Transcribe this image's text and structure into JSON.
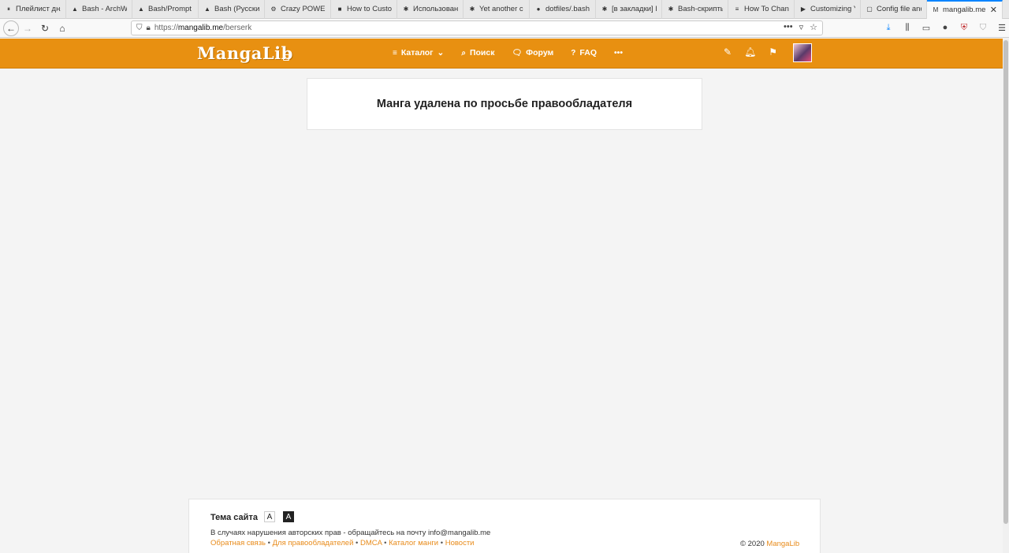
{
  "browser": {
    "tabs": [
      {
        "title": "Плейлист дня",
        "icon": "pause-icon",
        "fav": "⏸"
      },
      {
        "title": "Bash - ArchWiki",
        "icon": "arch-icon",
        "fav": "▲"
      },
      {
        "title": "Bash/Prompt",
        "icon": "arch-icon",
        "fav": "▲"
      },
      {
        "title": "Bash (Русский)",
        "icon": "arch-icon",
        "fav": "▲"
      },
      {
        "title": "Crazy POWERFUL",
        "icon": "site-icon",
        "fav": "⚙"
      },
      {
        "title": "How to Custom",
        "icon": "htg-icon",
        "fav": "■"
      },
      {
        "title": "Использован",
        "icon": "site-icon",
        "fav": "✱"
      },
      {
        "title": "Yet another c",
        "icon": "site-icon",
        "fav": "✱"
      },
      {
        "title": "dotfiles/.bash",
        "icon": "github-icon",
        "fav": "●"
      },
      {
        "title": "[в закладки] Б",
        "icon": "site-icon",
        "fav": "✱"
      },
      {
        "title": "Bash-скрипты",
        "icon": "site-icon",
        "fav": "✱"
      },
      {
        "title": "How To Chang",
        "icon": "site-icon",
        "fav": "≡"
      },
      {
        "title": "Customizing Y",
        "icon": "youtube-icon",
        "fav": "▶"
      },
      {
        "title": "Config file and",
        "icon": "doc-icon",
        "fav": "▢"
      },
      {
        "title": "mangalib.me",
        "icon": "mangalib-icon",
        "fav": "M",
        "active": true
      }
    ],
    "url": {
      "scheme": "https://",
      "host": "mangalib.me",
      "path": "/berserk"
    }
  },
  "site": {
    "logo": "MangaLib",
    "menu": [
      {
        "label": "Каталог",
        "icon": "menu-icon",
        "glyph": "≡",
        "dropdown": "⌄"
      },
      {
        "label": "Поиск",
        "icon": "search-icon",
        "glyph": "⌕"
      },
      {
        "label": "Форум",
        "icon": "chat-icon",
        "glyph": "🗨"
      },
      {
        "label": "FAQ",
        "icon": "question-icon",
        "glyph": "?"
      },
      {
        "label": "•••",
        "icon": "more-icon",
        "glyph": ""
      }
    ]
  },
  "main": {
    "notice": "Манга удалена по просьбе правообладателя"
  },
  "footer": {
    "theme_label": "Тема сайта",
    "theme_light": "A",
    "theme_dark": "A",
    "copyright_note": "В случаях нарушения авторских прав - обращайтесь на почту info@mangalib.me",
    "links": [
      "Обратная связь",
      "Для правообладателей",
      "DMCA",
      "Каталог манги",
      "Новости"
    ],
    "separator": "•",
    "copy_prefix": "© 2020",
    "copy_brand": "MangaLib"
  },
  "colors": {
    "brand": "#e89011",
    "link": "#e88b1a"
  }
}
